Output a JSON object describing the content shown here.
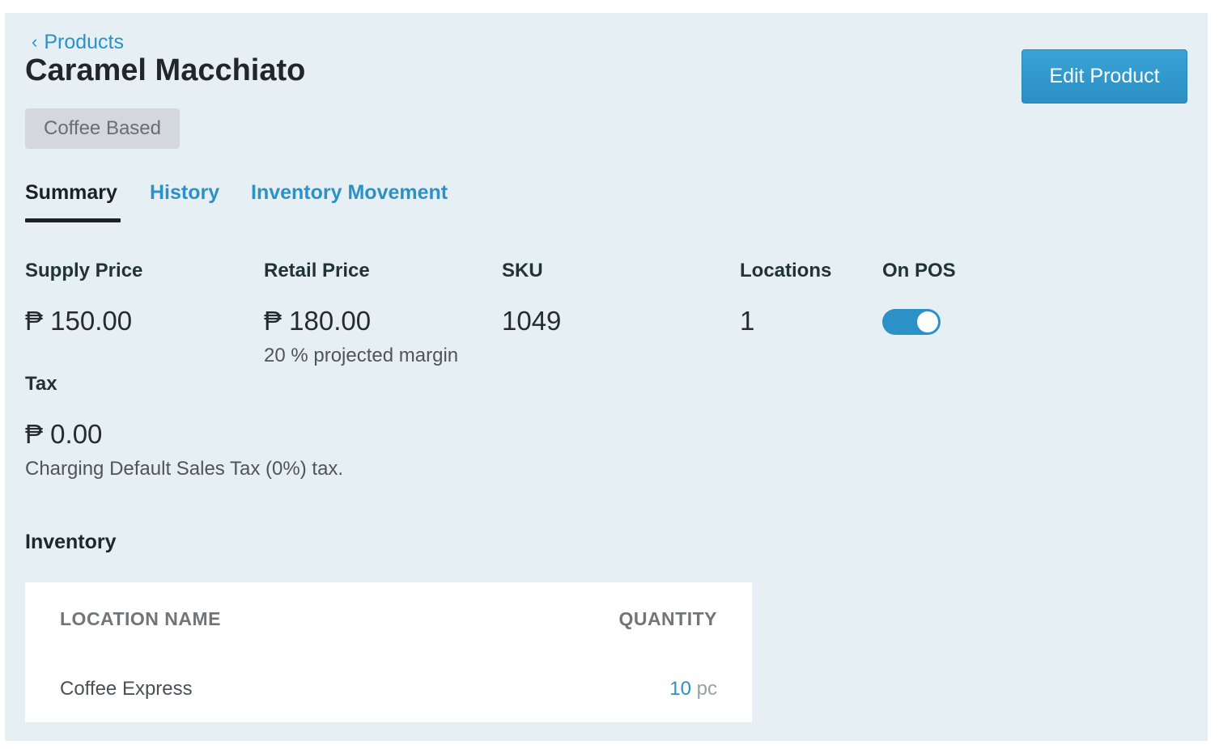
{
  "breadcrumb": {
    "back_label": "Products"
  },
  "product": {
    "name": "Caramel Macchiato",
    "category": "Coffee Based"
  },
  "actions": {
    "edit_label": "Edit Product"
  },
  "tabs": [
    {
      "label": "Summary",
      "active": true
    },
    {
      "label": "History",
      "active": false
    },
    {
      "label": "Inventory Movement",
      "active": false
    }
  ],
  "summary": {
    "supply_price": {
      "label": "Supply Price",
      "value": "₱ 150.00"
    },
    "retail_price": {
      "label": "Retail Price",
      "value": "₱ 180.00",
      "note": "20 % projected margin"
    },
    "sku": {
      "label": "SKU",
      "value": "1049"
    },
    "locations": {
      "label": "Locations",
      "value": "1"
    },
    "on_pos": {
      "label": "On POS",
      "enabled": true
    },
    "tax": {
      "label": "Tax",
      "value": "₱ 0.00",
      "note": "Charging Default Sales Tax (0%) tax."
    }
  },
  "inventory": {
    "title": "Inventory",
    "columns": [
      "LOCATION NAME",
      "QUANTITY"
    ],
    "rows": [
      {
        "location": "Coffee Express",
        "quantity": "10",
        "unit": "pc"
      }
    ]
  },
  "colors": {
    "accent": "#2b91c7",
    "panel_background": "#e6eff3",
    "badge_background": "#d4d8de"
  },
  "icons": {
    "back": "chevron-left-icon"
  }
}
